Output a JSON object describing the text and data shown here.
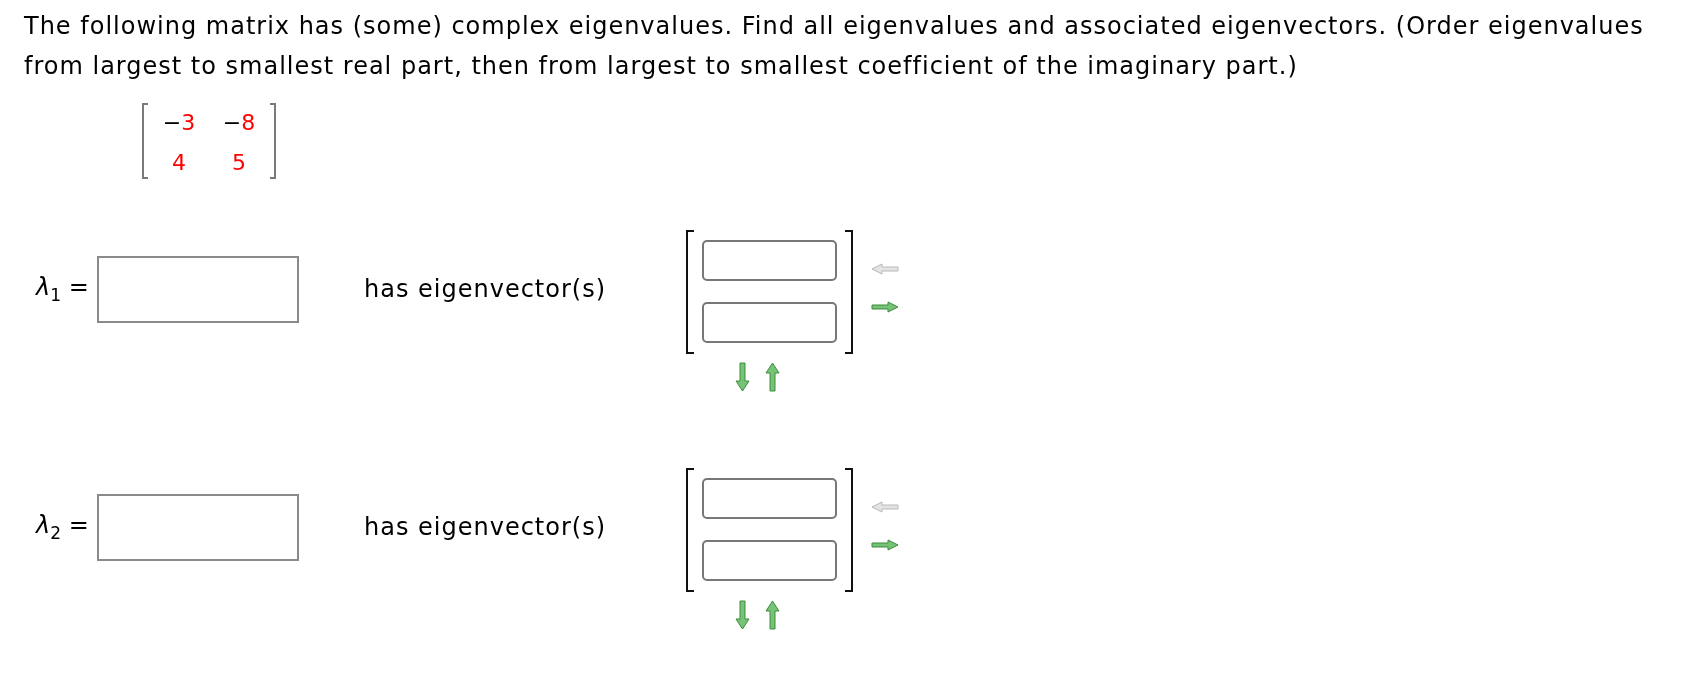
{
  "question": "The following matrix has (some) complex eigenvalues. Find all eigenvalues and associated eigenvectors. (Order eigenvalues from largest to smallest real part, then from largest to smallest coefficient of the imaginary part.)",
  "matrix": {
    "rows": [
      [
        {
          "sign": "−",
          "digits": "3"
        },
        {
          "sign": "−",
          "digits": "8"
        }
      ],
      [
        {
          "digits": "4"
        },
        {
          "digits": "5"
        }
      ]
    ]
  },
  "eigenpairs": [
    {
      "label": "*λ*$_{1}$ =",
      "text": "has eigenvector(s)",
      "entries": [
        {
          "kind": "blank"
        },
        {
          "kind": "blank"
        }
      ],
      "controls": [
        {
          "kind": "left",
          "disabled": true
        },
        {
          "kind": "right",
          "disabled": false
        },
        {
          "kind": "down",
          "disabled": false
        },
        {
          "kind": "up",
          "disabled": false
        }
      ]
    },
    {
      "label": "*λ*$_{2}$ =",
      "text": "has eigenvector(s)",
      "entries": [
        {
          "kind": "blank"
        },
        {
          "kind": "blank"
        }
      ],
      "controls": [
        {
          "kind": "left",
          "disabled": true
        },
        {
          "kind": "right",
          "disabled": false
        },
        {
          "kind": "down",
          "disabled": false
        },
        {
          "kind": "up",
          "disabled": false
        }
      ]
    }
  ]
}
